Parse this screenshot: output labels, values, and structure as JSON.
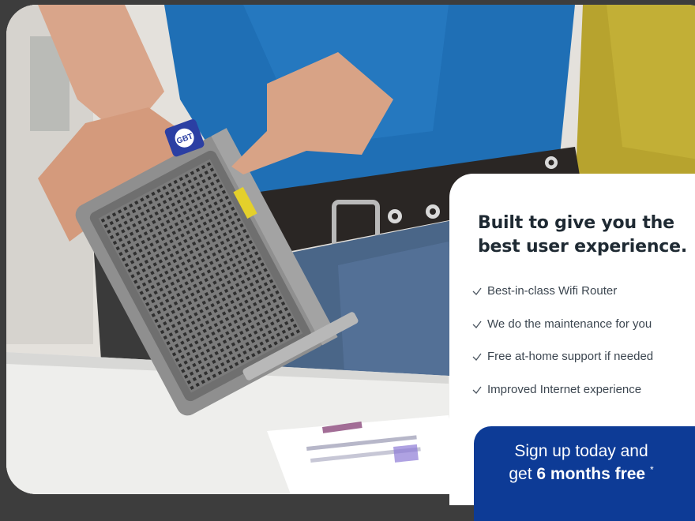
{
  "hero": {
    "image": "technician-holding-wifi-router-photo",
    "router_badge": "GBT"
  },
  "card": {
    "heading_line1": "Built to give you the",
    "heading_line2": "best user experience.",
    "features": [
      {
        "icon": "check-icon",
        "label": "Best-in-class Wifi Router"
      },
      {
        "icon": "check-icon",
        "label": "We do the maintenance for you"
      },
      {
        "icon": "check-icon",
        "label": "Free at-home support if needed"
      },
      {
        "icon": "check-icon",
        "label": "Improved Internet experience"
      }
    ],
    "cta": {
      "line1": "Sign up today and",
      "line2_prefix": "get ",
      "line2_bold": "6 months free",
      "footnote_mark": "*"
    }
  },
  "colors": {
    "page_bg": "#3d3d3d",
    "card_bg": "#ffffff",
    "cta_bg": "#0d3b96",
    "heading": "#1f2a33",
    "shirt": "#1f6fb5",
    "router": "#8f8f8f"
  }
}
